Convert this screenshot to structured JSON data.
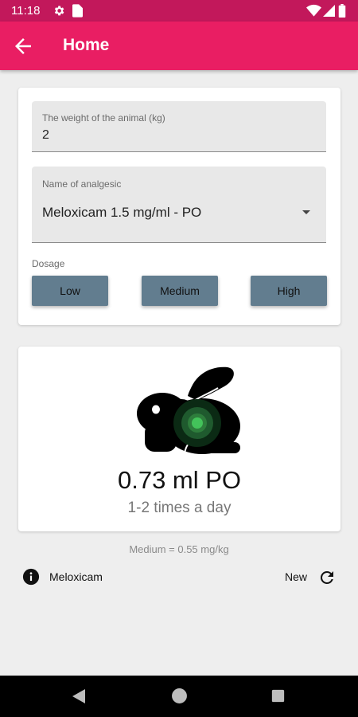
{
  "status_bar": {
    "time": "11:18",
    "icons": [
      "gear-icon",
      "sim-card-icon",
      "wifi-icon",
      "signal-icon",
      "battery-icon"
    ]
  },
  "app_bar": {
    "title": "Home",
    "back_icon": "arrow-back-icon",
    "color": "#e91e63"
  },
  "form": {
    "weight": {
      "label": "The weight of the animal (kg)",
      "value": "2"
    },
    "analgesic": {
      "label": "Name of analgesic",
      "value": "Meloxicam 1.5 mg/ml - PO"
    },
    "dosage": {
      "label": "Dosage",
      "buttons": [
        {
          "label": "Low"
        },
        {
          "label": "Medium"
        },
        {
          "label": "High"
        }
      ],
      "button_color": "#627d8f"
    }
  },
  "result": {
    "animal_icon": "rabbit-icon",
    "amount": "0.73 ml PO",
    "frequency": "1-2 times a day"
  },
  "dose_info": "Medium = 0.55 mg/kg",
  "footer": {
    "info_label": "Meloxicam",
    "new_label": "New",
    "info_icon": "info-icon",
    "refresh_icon": "refresh-icon"
  },
  "nav_bar": {
    "icons": [
      "nav-back-icon",
      "nav-home-icon",
      "nav-recent-icon"
    ]
  }
}
